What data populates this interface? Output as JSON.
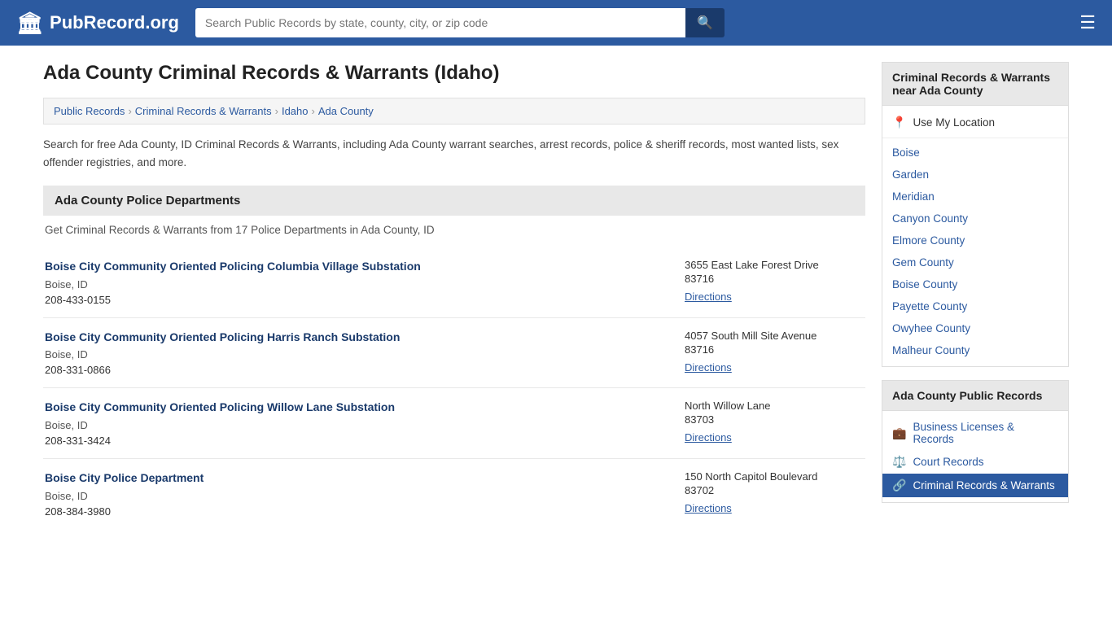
{
  "header": {
    "logo_icon": "🏛",
    "logo_text": "PubRecord.org",
    "search_placeholder": "Search Public Records by state, county, city, or zip code",
    "search_button_icon": "🔍",
    "menu_icon": "☰"
  },
  "page": {
    "title": "Ada County Criminal Records & Warrants (Idaho)",
    "breadcrumb": [
      {
        "label": "Public Records",
        "href": "#"
      },
      {
        "label": "Criminal Records & Warrants",
        "href": "#"
      },
      {
        "label": "Idaho",
        "href": "#"
      },
      {
        "label": "Ada County",
        "href": "#"
      }
    ],
    "description": "Search for free Ada County, ID Criminal Records & Warrants, including Ada County warrant searches, arrest records, police & sheriff records, most wanted lists, sex offender registries, and more.",
    "section_header": "Ada County Police Departments",
    "section_sub": "Get Criminal Records & Warrants from 17 Police Departments in Ada County, ID",
    "records": [
      {
        "name": "Boise City Community Oriented Policing Columbia Village Substation",
        "city": "Boise, ID",
        "phone": "208-433-0155",
        "address": "3655 East Lake Forest Drive",
        "zip": "83716",
        "directions": "Directions"
      },
      {
        "name": "Boise City Community Oriented Policing Harris Ranch Substation",
        "city": "Boise, ID",
        "phone": "208-331-0866",
        "address": "4057 South Mill Site Avenue",
        "zip": "83716",
        "directions": "Directions"
      },
      {
        "name": "Boise City Community Oriented Policing Willow Lane Substation",
        "city": "Boise, ID",
        "phone": "208-331-3424",
        "address": "North Willow Lane",
        "zip": "83703",
        "directions": "Directions"
      },
      {
        "name": "Boise City Police Department",
        "city": "Boise, ID",
        "phone": "208-384-3980",
        "address": "150 North Capitol Boulevard",
        "zip": "83702",
        "directions": "Directions"
      }
    ]
  },
  "sidebar": {
    "nearby_title": "Criminal Records & Warrants near Ada County",
    "location_label": "Use My Location",
    "nearby_links": [
      {
        "label": "Boise"
      },
      {
        "label": "Garden"
      },
      {
        "label": "Meridian"
      },
      {
        "label": "Canyon County"
      },
      {
        "label": "Elmore County"
      },
      {
        "label": "Gem County"
      },
      {
        "label": "Boise County"
      },
      {
        "label": "Payette County"
      },
      {
        "label": "Owyhee County"
      },
      {
        "label": "Malheur County"
      }
    ],
    "public_records_title": "Ada County Public Records",
    "public_records_links": [
      {
        "label": "Business Licenses & Records",
        "icon": "💼",
        "active": false
      },
      {
        "label": "Court Records",
        "icon": "⚖️",
        "active": false
      },
      {
        "label": "Criminal Records & Warrants",
        "icon": "🔗",
        "active": true
      }
    ]
  }
}
